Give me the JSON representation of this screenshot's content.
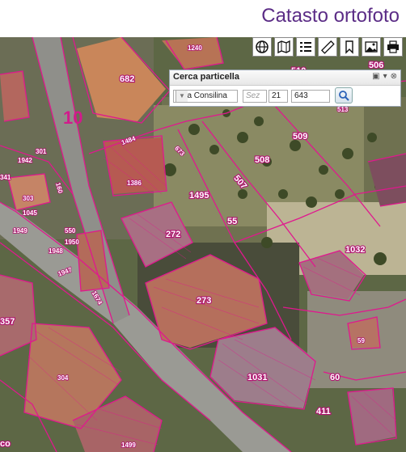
{
  "app": {
    "title": "Catasto ortofoto"
  },
  "toolbar": {
    "tools": [
      {
        "name": "globe-icon",
        "glyph": "🌐"
      },
      {
        "name": "map-icon",
        "glyph": "🗺"
      },
      {
        "name": "list-icon",
        "glyph": "☰"
      },
      {
        "name": "ruler-icon",
        "glyph": "📏"
      },
      {
        "name": "bookmark-icon",
        "glyph": "🔖"
      },
      {
        "name": "image-icon",
        "glyph": "🖼"
      },
      {
        "name": "print-icon",
        "glyph": "🖨"
      }
    ]
  },
  "search_panel": {
    "title": "Cerca particella",
    "comune_value": "Sala Consilina",
    "sez_placeholder": "Sez",
    "foglio_value": "21",
    "particella_value": "643",
    "search_icon": "magnifier-icon"
  },
  "map": {
    "sheet_label": "10",
    "parcels": [
      "1240",
      "682",
      "510",
      "506",
      "513",
      "509",
      "508",
      "1484",
      "673",
      "301",
      "1942",
      "1386",
      "507",
      "341",
      "303",
      "1045",
      "1495",
      "55",
      "1949",
      "550",
      "1950",
      "272",
      "1948",
      "1032",
      "1947",
      "273",
      "1674",
      "357",
      "59",
      "304",
      "1031",
      "60",
      "411",
      "1499",
      "co"
    ],
    "colors": {
      "parcel_line": "#e0188e",
      "label_text": "#ffffff",
      "label_halo": "#b0126f"
    }
  }
}
